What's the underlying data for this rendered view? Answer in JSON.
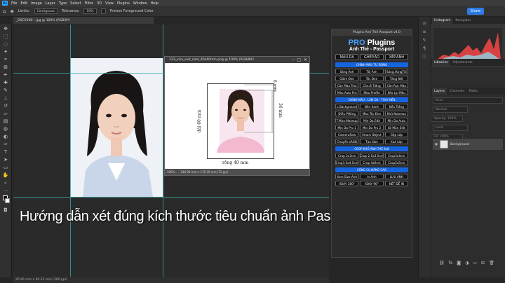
{
  "menu": {
    "items": [
      "File",
      "Edit",
      "Image",
      "Layer",
      "Type",
      "Select",
      "Filter",
      "3D",
      "View",
      "Plugins",
      "Window",
      "Help"
    ]
  },
  "options": {
    "limits_label": "Limits:",
    "limits_value": "Contiguous",
    "tolerance_label": "Tolerance:",
    "tolerance_value": "50%",
    "protect_label": "Protect Foreground Color",
    "share": "Share"
  },
  "document": {
    "tab": "_DSC0198~.jpg @ 100% (RGB/8*)",
    "status": "26.96 mm x 90.22 mm (300 ppi)"
  },
  "subwindow": {
    "title": "123_visa_viet_nam_40x60mm.png @ 100% (RGB/8#)",
    "zoom": "100%",
    "size": "246.94 mm x 176.39 mm (72 ppi)",
    "dim_6": "6 mm",
    "dim_36": "36 mm",
    "dim_60": "dài 60 mm",
    "dim_40": "rộng 40 mm"
  },
  "caption": "Hướng dẫn xét đúng kích thước tiêu chuẩn ảnh Passport",
  "plugin": {
    "title": "Plugins Ảnh Thẻ Passport v4.0",
    "logo_pro": "PRO",
    "logo_plugins": "Plugins",
    "logo_sub": "Ảnh Thẻ - Passport",
    "top_buttons": [
      "MÀU.DA",
      "GHÉP.ÁO",
      "XẾP.ẢNH"
    ],
    "sections": [
      {
        "title": "CHỈNH MÀU TỰ ĐỘNG",
        "buttons": [
          [
            "Sáng Ảnh",
            "Tối Ảnh",
            "Sáng.VùngTối"
          ],
          [
            "Giảm Đen",
            "Tóc Đen",
            "Tăng Nét"
          ],
          [
            "Cân Màu Test",
            "Cân.B.Trắng",
            "Căn Rực Màu"
          ],
          [
            "Màu Auto Pro",
            "Màu Profile",
            "Kéo Lại Màu"
          ]
        ]
      },
      {
        "title": "CHỈNH MÀU - LÀM DA - THAY NỀN",
        "buttons": [
          [
            "L.Background",
            "Nền Xanh",
            "Nền Trắng"
          ],
          [
            "Điều PHông",
            "Màu Tóc Đen",
            "Khử Noisewa"
          ],
          [
            "T.Mùn.Makeup",
            "Mịn Da Edit",
            "Mịn Da Auto"
          ],
          [
            "Mịn Da Pro 1",
            "Mịn Da Pro 2",
            "Xé Mún Edit"
          ],
          [
            "CameraRaw",
            "Smart Object",
            "Gộp Lớp"
          ],
          [
            "Chuyển.sRGB",
            "Tạo Size",
            "Xoá Lớp"
          ]
        ]
      },
      {
        "title": "CROP KHỔ ẢNH THẺ 8x8",
        "buttons": [
          [
            "Crop 2x3cm",
            "Crop 2.5x3.5cm",
            "Crop3x4cm"
          ],
          [
            "Crop3.5x4.5cm",
            "Crop 4x6cm",
            "Crop5x5cm"
          ]
        ]
      },
      {
        "title": "CÔNG CỤ NÂNG CAO",
        "buttons": [
          [
            "Xem.Size.Ảnh",
            "In Ảnh",
            "LƯU ẢNH"
          ],
          [
            "XOAY 180°",
            "XOAY 90°",
            "NÉT ĐỂ IN"
          ]
        ]
      }
    ]
  },
  "panels": {
    "histogram_tab": "Histogram",
    "navigator_tab": "Navigator",
    "libraries_tab": "Libraries",
    "adjustments_tab": "Adjustments",
    "layers_tab": "Layers",
    "channels_tab": "Channels",
    "paths_tab": "Paths",
    "kind": "Kind",
    "normal": "Normal",
    "opacity": "Opacity: 100%",
    "lock": "Lock:",
    "fill": "Fill: 100%",
    "layer_name": "Background"
  }
}
